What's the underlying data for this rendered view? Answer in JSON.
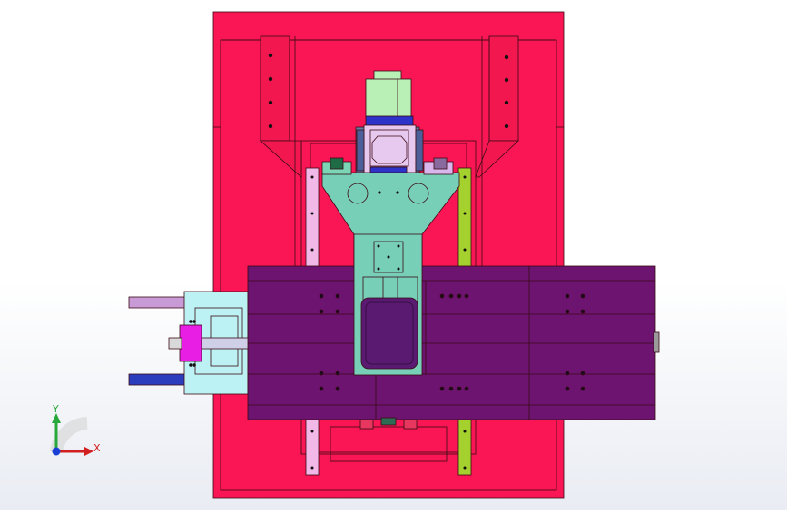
{
  "viewport": {
    "view": "top",
    "triad": {
      "x_label": "X",
      "y_label": "Y",
      "x_color": "#d21f1f",
      "y_color": "#27a83a",
      "origin_color": "#1a3fd6"
    }
  },
  "model": {
    "colors": {
      "base_plate": "#fa1654",
      "column_brackets": "#f3174f",
      "saddle": "#78cfb8",
      "spindle_motor": "#b8f0b6",
      "spindle_head": "#e7c8ef",
      "spindle_band": "#2d33c8",
      "worktable": "#6d1470",
      "worktable_dark": "#5a0f5d",
      "tool_magazine": "#5b1a72",
      "rail_left": "#f2b9e8",
      "rail_right": "#a5d12f",
      "side_rail_top": "#c89ad6",
      "side_rail_bottom": "#2b3dbd",
      "drive_unit": "#bdf2f4",
      "drive_motor": "#e81ee5"
    }
  }
}
